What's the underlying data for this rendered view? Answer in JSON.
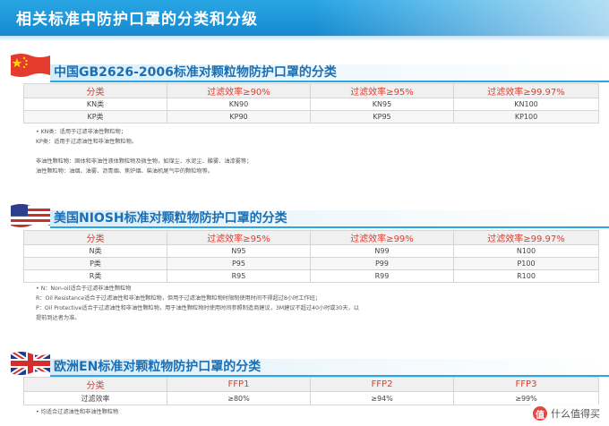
{
  "banner": {
    "title": "相关标准中防护口罩的分类和分级"
  },
  "sections": [
    {
      "title": "中国GB2626-2006标准对颗粒物防护口罩的分类",
      "head": [
        "分类",
        "过滤效率≥90%",
        "过滤效率≥95%",
        "过滤效率≥99.97%"
      ],
      "rows": [
        [
          "KN类",
          "KN90",
          "KN95",
          "KN100"
        ],
        [
          "KP类",
          "KP90",
          "KP95",
          "KP100"
        ]
      ],
      "notes": [
        "• KN类：适用于过滤非油性颗粒物；",
        "KP类：适用于过滤油性和非油性颗粒物。",
        "",
        "非油性颗粒物：固体和非油性液体颗粒物及微生物，如煤尘、水泥尘、酸雾、油漆雾等；",
        "油性颗粒物：油烟、油雾、沥青烟、焦炉烟、柴油机尾气中的颗粒物等。"
      ]
    },
    {
      "title": "美国NIOSH标准对颗粒物防护口罩的分类",
      "head": [
        "分类",
        "过滤效率≥95%",
        "过滤效率≥99%",
        "过滤效率≥99.97%"
      ],
      "rows": [
        [
          "N类",
          "N95",
          "N99",
          "N100"
        ],
        [
          "P类",
          "P95",
          "P99",
          "P100"
        ],
        [
          "R类",
          "R95",
          "R99",
          "R100"
        ]
      ],
      "notes": [
        "• N：Non-oil适合于过滤非油性颗粒物",
        "R：Oil Resistance适合于过滤油性和非油性颗粒物，但用于过滤油性颗粒物时限制使用时间不得超过8小时工作班；",
        "P：Oil Protective适合于过滤油性和非油性颗粒物，用于油性颗粒物时使用时间参照制造商建议，3M建议不超过40小时或30天，以",
        "提前到达者为准。"
      ]
    },
    {
      "title": "欧洲EN标准对颗粒物防护口罩的分类",
      "head": [
        "分类",
        "FFP1",
        "FFP2",
        "FFP3"
      ],
      "rows": [
        [
          "过滤效率",
          "≥80%",
          "≥94%",
          "≥99%"
        ]
      ],
      "notes": [
        "• 均适合过滤油性和非油性颗粒物"
      ]
    }
  ],
  "watermark": {
    "logo": "值",
    "text": "什么值得买"
  },
  "colors": {
    "banner_blue": "#1689cf",
    "title_blue": "#1a6fb5",
    "header_red": "#e33a2c",
    "cn_flag_red": "#e53b2c",
    "cn_flag_star": "#ffdd00",
    "us_flag_red": "#c8302b",
    "us_flag_blue": "#2b3f8c",
    "uk_flag_blue": "#1f3a8f",
    "uk_flag_red": "#d22e2e"
  }
}
